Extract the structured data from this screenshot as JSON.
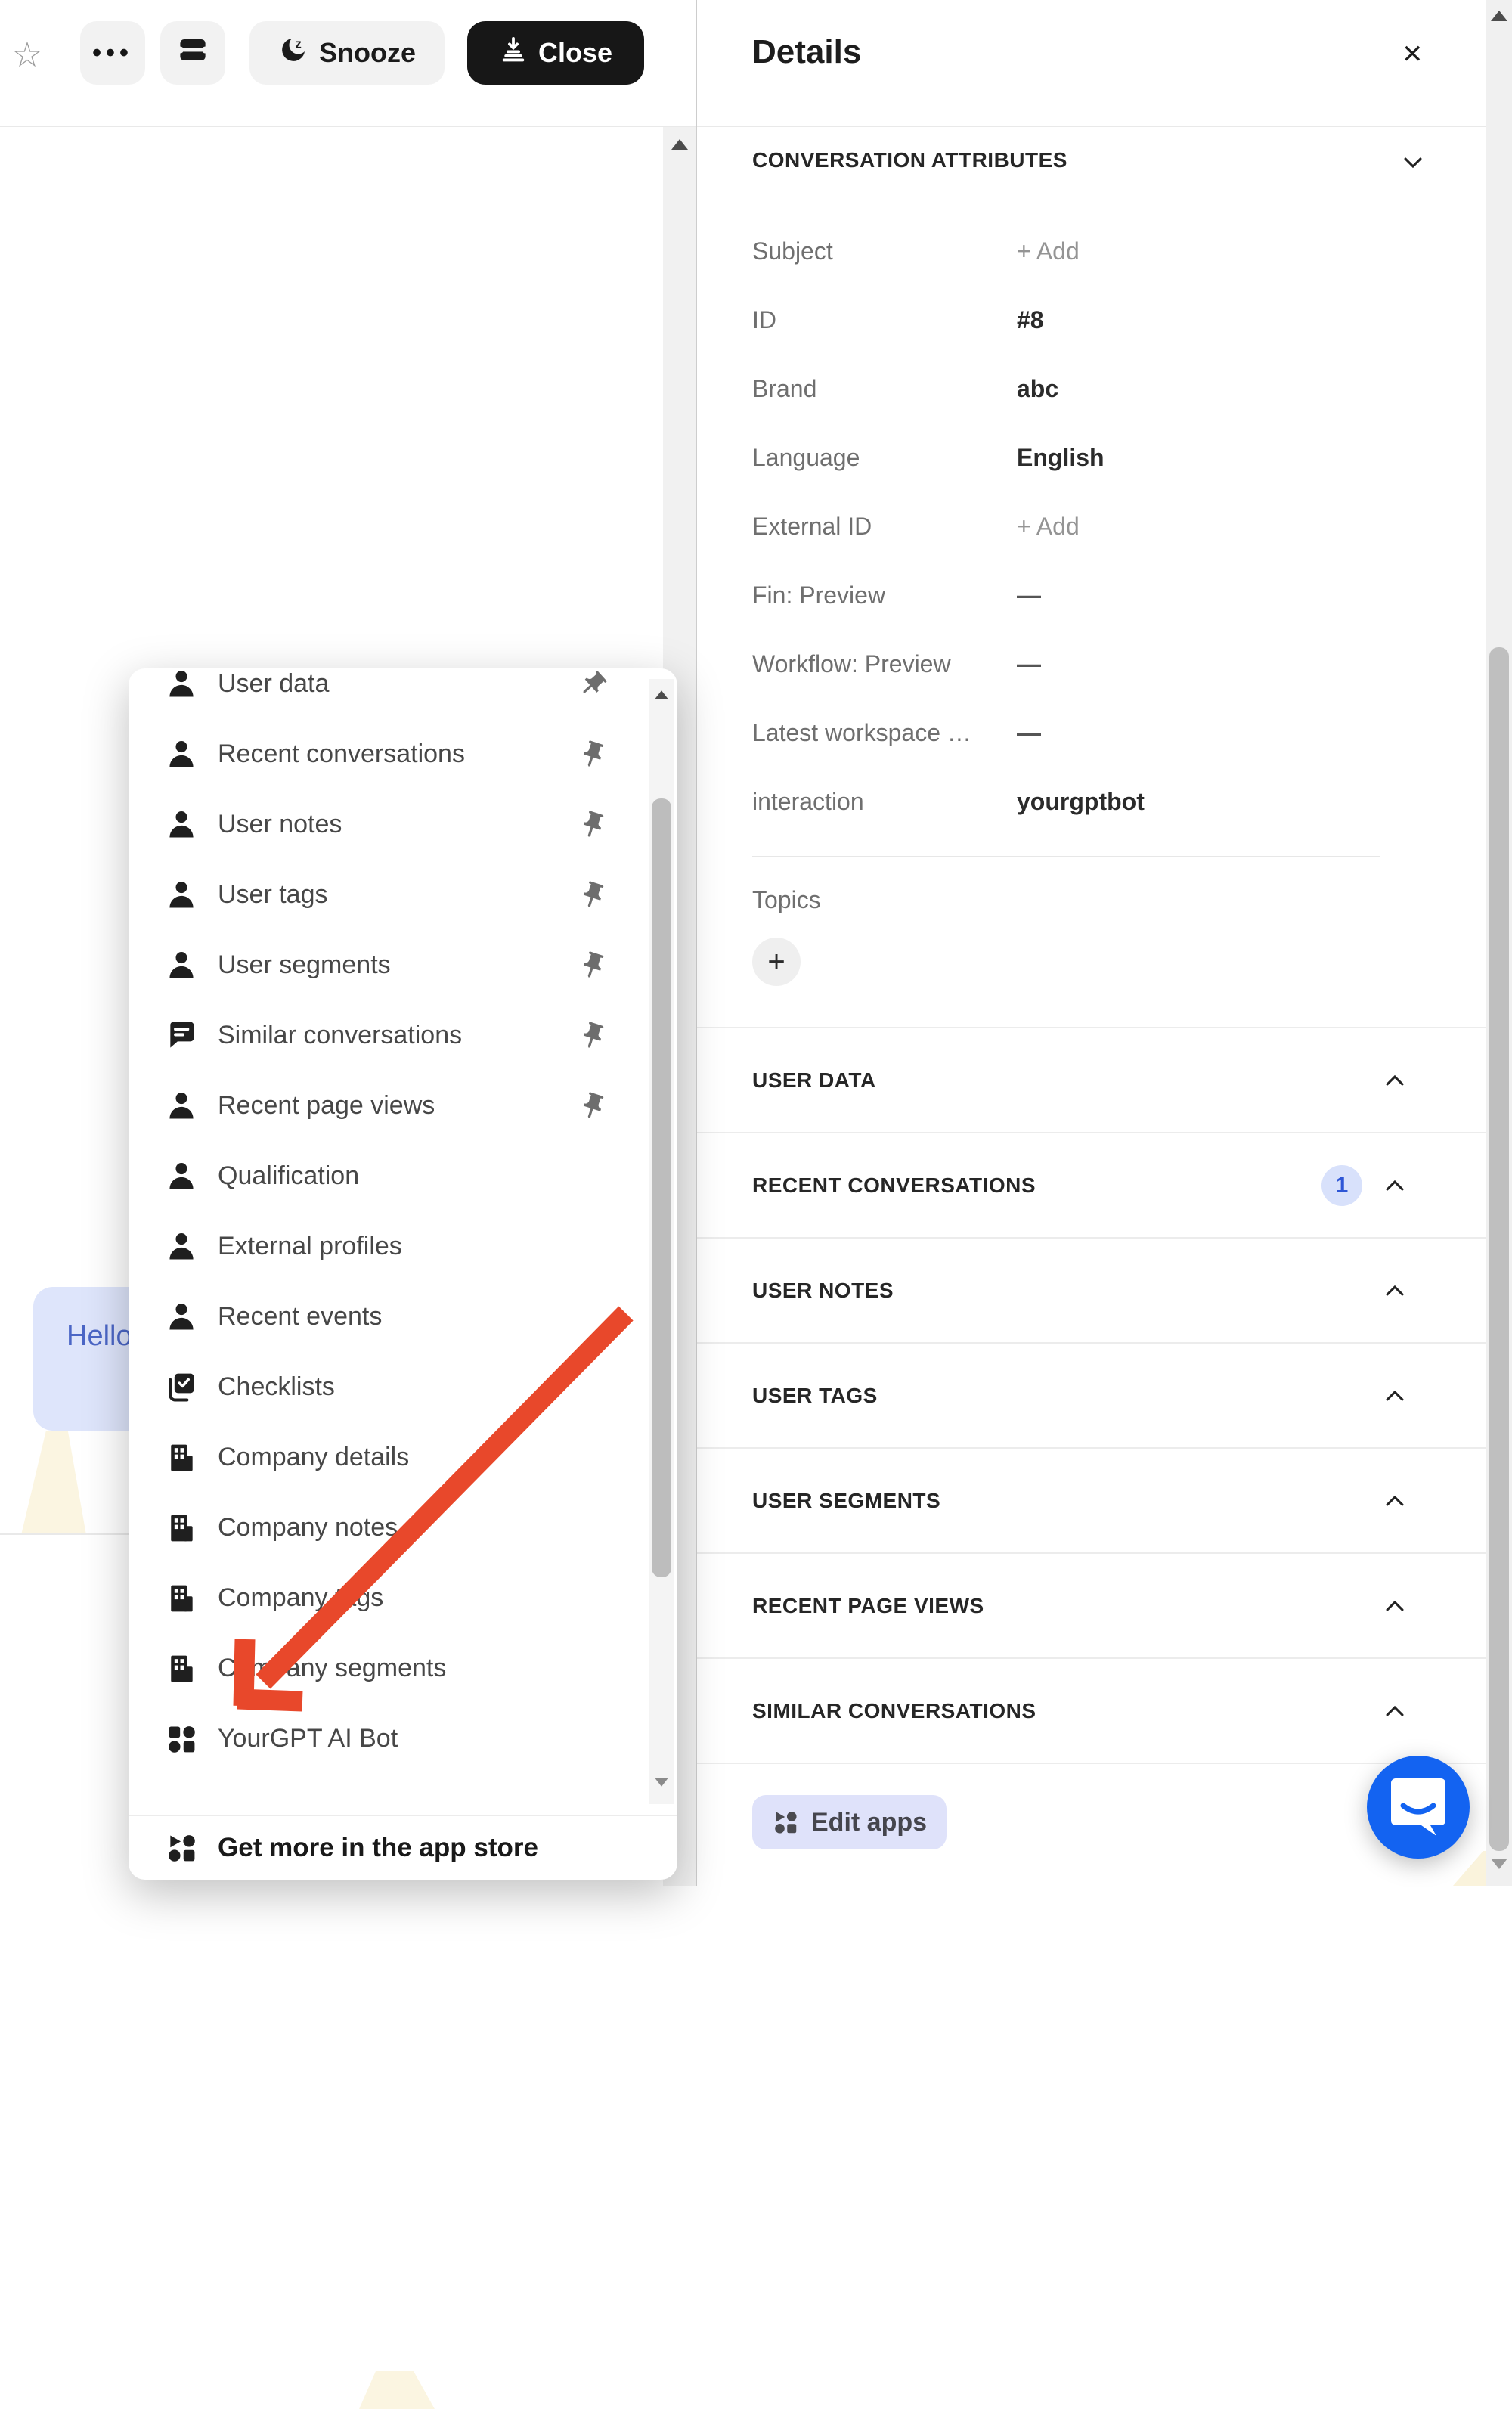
{
  "toolbar": {
    "star_icon": "star",
    "more_label": "•••",
    "snooze_label": "Snooze",
    "close_label": "Close"
  },
  "left_pane": {
    "message_bubble_text": "Hello"
  },
  "dropdown": {
    "items": [
      {
        "label": "User data",
        "icon": "person-icon",
        "pinned": true,
        "pin_variant": "strong"
      },
      {
        "label": "Recent conversations",
        "icon": "person-icon",
        "pinned": true,
        "pin_variant": "normal"
      },
      {
        "label": "User notes",
        "icon": "person-icon",
        "pinned": true,
        "pin_variant": "normal"
      },
      {
        "label": "User tags",
        "icon": "person-icon",
        "pinned": true,
        "pin_variant": "normal"
      },
      {
        "label": "User segments",
        "icon": "person-icon",
        "pinned": true,
        "pin_variant": "normal"
      },
      {
        "label": "Similar conversations",
        "icon": "chat-bubble-icon",
        "pinned": true,
        "pin_variant": "normal"
      },
      {
        "label": "Recent page views",
        "icon": "person-icon",
        "pinned": true,
        "pin_variant": "normal"
      },
      {
        "label": "Qualification",
        "icon": "person-icon",
        "pinned": false
      },
      {
        "label": "External profiles",
        "icon": "person-icon",
        "pinned": false
      },
      {
        "label": "Recent events",
        "icon": "person-icon",
        "pinned": false
      },
      {
        "label": "Checklists",
        "icon": "checklist-icon",
        "pinned": false
      },
      {
        "label": "Company details",
        "icon": "building-icon",
        "pinned": false
      },
      {
        "label": "Company notes",
        "icon": "building-icon",
        "pinned": false
      },
      {
        "label": "Company tags",
        "icon": "building-icon",
        "pinned": false
      },
      {
        "label": "Company segments",
        "icon": "building-icon",
        "pinned": false
      },
      {
        "label": "YourGPT AI Bot",
        "icon": "app-grid-icon",
        "pinned": false
      }
    ],
    "footer": {
      "label": "Get more in the app store",
      "icon": "app-store-grid-icon"
    }
  },
  "details": {
    "title": "Details",
    "close_icon": "✕",
    "attributes_header": "CONVERSATION ATTRIBUTES",
    "attributes": [
      {
        "label": "Subject",
        "value": "+ Add",
        "type": "add"
      },
      {
        "label": "ID",
        "value": "#8",
        "type": "text"
      },
      {
        "label": "Brand",
        "value": "abc",
        "type": "text"
      },
      {
        "label": "Language",
        "value": "English",
        "type": "text"
      },
      {
        "label": "External ID",
        "value": "+ Add",
        "type": "add"
      },
      {
        "label": "Fin: Preview",
        "value": "—",
        "type": "dash"
      },
      {
        "label": "Workflow: Preview",
        "value": "—",
        "type": "dash"
      },
      {
        "label": "Latest workspace …",
        "value": "—",
        "type": "dash"
      },
      {
        "label": "interaction",
        "value": "yourgptbot",
        "type": "text"
      }
    ],
    "topics": {
      "label": "Topics",
      "add_button": "+"
    },
    "sections": [
      {
        "label": "USER DATA"
      },
      {
        "label": "RECENT CONVERSATIONS",
        "badge": "1"
      },
      {
        "label": "USER NOTES"
      },
      {
        "label": "USER TAGS"
      },
      {
        "label": "USER SEGMENTS"
      },
      {
        "label": "RECENT PAGE VIEWS"
      },
      {
        "label": "SIMILAR CONVERSATIONS"
      }
    ],
    "edit_apps_label": "Edit apps"
  },
  "colors": {
    "accent_blue": "#2e56d6",
    "badge_bg": "#d8e1fb",
    "launcher_blue": "#1363f1",
    "annotation_arrow": "#e8482b",
    "bubble_bg": "#dee5fb",
    "bubble_text": "#4b66c6",
    "edit_apps_bg": "#dfe2fa"
  }
}
